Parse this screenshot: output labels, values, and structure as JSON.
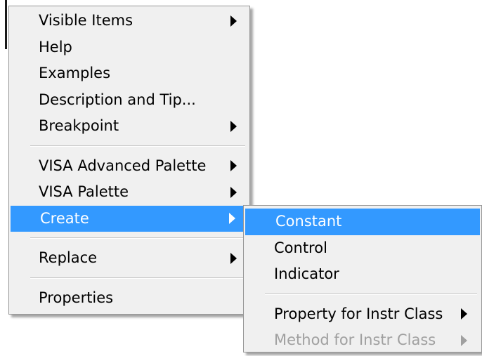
{
  "main_menu": {
    "items": [
      {
        "label": "Visible Items",
        "submenu": true
      },
      {
        "label": "Help",
        "submenu": false
      },
      {
        "label": "Examples",
        "submenu": false
      },
      {
        "label": "Description and Tip...",
        "submenu": false
      },
      {
        "label": "Breakpoint",
        "submenu": true
      },
      {
        "label": "VISA Advanced Palette",
        "submenu": true
      },
      {
        "label": "VISA Palette",
        "submenu": true
      },
      {
        "label": "Create",
        "submenu": true,
        "highlighted": true
      },
      {
        "label": "Replace",
        "submenu": true
      },
      {
        "label": "Properties",
        "submenu": false
      }
    ]
  },
  "create_submenu": {
    "items": [
      {
        "label": "Constant",
        "highlighted": true
      },
      {
        "label": "Control"
      },
      {
        "label": "Indicator"
      },
      {
        "label": "Property for Instr Class",
        "submenu": true
      },
      {
        "label": "Method for Instr Class",
        "submenu": true,
        "disabled": true
      }
    ]
  },
  "colors": {
    "highlight": "#3399ff",
    "menu_background": "#f0f0f0",
    "disabled_text": "#a0a0a0"
  }
}
